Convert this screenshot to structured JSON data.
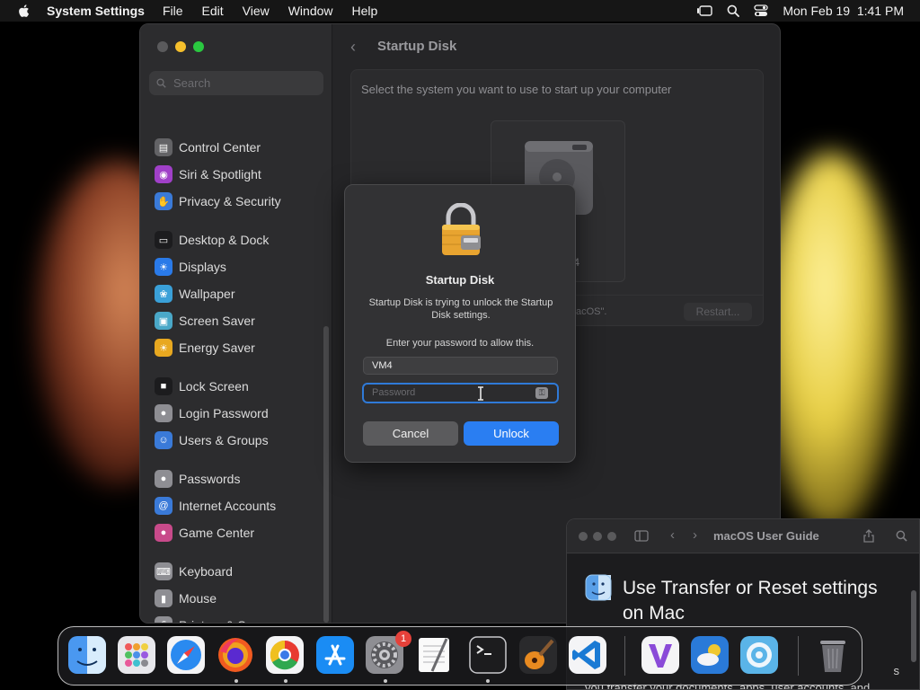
{
  "menubar": {
    "app_name": "System Settings",
    "items": [
      "File",
      "Edit",
      "View",
      "Window",
      "Help"
    ],
    "datetime": "Mon Feb 19  1:41 PM"
  },
  "settings": {
    "search_placeholder": "Search",
    "sidebar": [
      {
        "label": "Control Center",
        "icon": "control-center-icon",
        "color": "#636366"
      },
      {
        "label": "Siri & Spotlight",
        "icon": "siri-icon",
        "color": "#a040c8"
      },
      {
        "label": "Privacy & Security",
        "icon": "hand-icon",
        "color": "#3a7ad8"
      },
      {
        "label": "Desktop & Dock",
        "icon": "desktop-icon",
        "color": "#1c1c1e"
      },
      {
        "label": "Displays",
        "icon": "sun-icon",
        "color": "#2a7ae8"
      },
      {
        "label": "Wallpaper",
        "icon": "wallpaper-icon",
        "color": "#3aa0d8"
      },
      {
        "label": "Screen Saver",
        "icon": "screen-saver-icon",
        "color": "#4aa8c8"
      },
      {
        "label": "Energy Saver",
        "icon": "bulb-icon",
        "color": "#e8a820"
      },
      {
        "label": "Lock Screen",
        "icon": "lock-icon",
        "color": "#1c1c1e"
      },
      {
        "label": "Login Password",
        "icon": "key-icon",
        "color": "#8e8e93"
      },
      {
        "label": "Users & Groups",
        "icon": "users-icon",
        "color": "#3a7ad8"
      },
      {
        "label": "Passwords",
        "icon": "key-icon",
        "color": "#8e8e93"
      },
      {
        "label": "Internet Accounts",
        "icon": "at-icon",
        "color": "#3a7ad8"
      },
      {
        "label": "Game Center",
        "icon": "game-center-icon",
        "color": "#c84a8a"
      },
      {
        "label": "Keyboard",
        "icon": "keyboard-icon",
        "color": "#8e8e93"
      },
      {
        "label": "Mouse",
        "icon": "mouse-icon",
        "color": "#8e8e93"
      },
      {
        "label": "Printers & Scanners",
        "icon": "printer-icon",
        "color": "#8e8e93"
      }
    ],
    "page_title": "Startup Disk",
    "prompt": "Select the system you want to use to start up your computer",
    "disk_name": ".4",
    "disk_status": "acOS\".",
    "restart_label": "Restart..."
  },
  "dialog": {
    "title": "Startup Disk",
    "message": "Startup Disk is trying to unlock the Startup Disk settings.",
    "enter_prompt": "Enter your password to allow this.",
    "username": "VM4",
    "password_placeholder": "Password",
    "cancel_label": "Cancel",
    "unlock_label": "Unlock",
    "accent": "#2a7ef2"
  },
  "help": {
    "title": "macOS User Guide",
    "heading": "Use Transfer or Reset settings on Mac",
    "body": "s",
    "body_line2": "you transfer your documents, apps, user accounts, and"
  },
  "dock": {
    "apps": [
      "Finder",
      "Launchpad",
      "Safari",
      "Firefox",
      "Chrome",
      "App Store",
      "System Settings",
      "TextEdit",
      "Terminal",
      "GarageBand",
      "Visual Studio Code",
      "Visual Studio",
      "Weather",
      "Screen Sharing",
      "Trash"
    ],
    "badge": "1"
  }
}
